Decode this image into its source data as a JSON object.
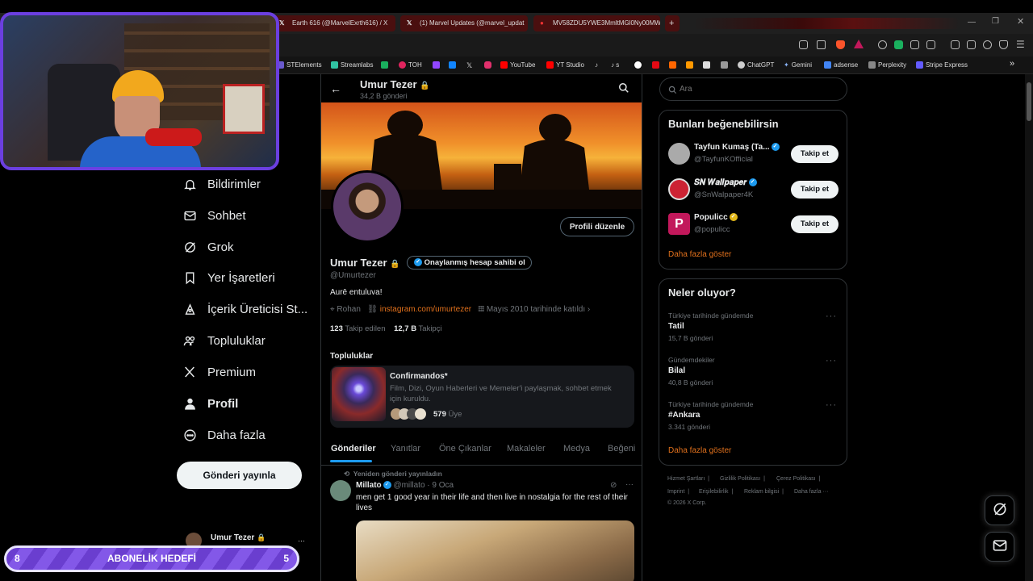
{
  "browser": {
    "tabs": [
      {
        "label": "Earth 616 (@MarvelExrth616) / X"
      },
      {
        "label": "(1) Marvel Updates (@marvel_updat"
      },
      {
        "label": "MV58ZDU5YWE3MmltMGl0Ny00MW"
      }
    ],
    "new_tab": "+",
    "bookmarks": [
      {
        "label": "STElements",
        "color": "#6a5acd"
      },
      {
        "label": "Streamlabs",
        "color": "#31c3a2"
      },
      {
        "label": "",
        "color": "#1ab05e"
      },
      {
        "label": "TOH",
        "color": "#e0245e"
      },
      {
        "label": "",
        "color": "#9146ff"
      },
      {
        "label": "",
        "color": "#1185fe"
      },
      {
        "label": "",
        "color": "#aaaaaa"
      },
      {
        "label": "",
        "color": "#e1306c"
      },
      {
        "label": "YouTube",
        "color": "#ff0000"
      },
      {
        "label": "YT Studio",
        "color": "#ff0000"
      },
      {
        "label": "",
        "color": "#cccccc"
      },
      {
        "label": "s",
        "color": "#cccccc"
      },
      {
        "label": "",
        "color": "#ffffff"
      },
      {
        "label": "",
        "color": "#e50914"
      },
      {
        "label": "",
        "color": "#ff6600"
      },
      {
        "label": "",
        "color": "#53fc18"
      },
      {
        "label": "",
        "color": "#ff9900"
      },
      {
        "label": "",
        "color": "#dddddd"
      },
      {
        "label": "ChatGPT",
        "color": "#cccccc"
      },
      {
        "label": "Gemini",
        "color": "#8ab4f8"
      },
      {
        "label": "adsense",
        "color": "#4285f4"
      },
      {
        "label": "Perplexity",
        "color": "#cccccc"
      },
      {
        "label": "Stripe Express",
        "color": "#635bff"
      }
    ],
    "more": "»"
  },
  "sidebar": {
    "items": [
      {
        "label": "Bildirimler",
        "icon": "bell-icon"
      },
      {
        "label": "Sohbet",
        "icon": "mail-icon"
      },
      {
        "label": "Grok",
        "icon": "grok-icon"
      },
      {
        "label": "Yer İşaretleri",
        "icon": "bookmark-icon"
      },
      {
        "label": "İçerik Üreticisi St...",
        "icon": "creator-icon"
      },
      {
        "label": "Topluluklar",
        "icon": "communities-icon"
      },
      {
        "label": "Premium",
        "icon": "x-logo-icon"
      },
      {
        "label": "Profil",
        "icon": "person-icon"
      },
      {
        "label": "Daha fazla",
        "icon": "more-circle-icon"
      }
    ],
    "post_button": "Gönderi yayınla",
    "account_name": "Umur Tezer",
    "account_more": "···"
  },
  "goal_overlay": {
    "left": "8",
    "title": "ABONELİK HEDEFİ",
    "right": "5"
  },
  "profile": {
    "header_name": "Umur Tezer",
    "header_posts": "34,2 B gönderi",
    "edit_button": "Profili düzenle",
    "name": "Umur Tezer",
    "verify_badge": "Onaylanmış hesap sahibi ol",
    "handle": "@Umurtezer",
    "bio": "Aurē entuluva!",
    "location": "Rohan",
    "link": "instagram.com/umurtezer",
    "joined": "Mayıs 2010 tarihinde katıldı",
    "following_count": "123",
    "following_label": "Takip edilen",
    "followers_count": "12,7 B",
    "followers_label": "Takipçi",
    "communities_heading": "Topluluklar",
    "community": {
      "name": "Confirmandos*",
      "desc": "Film, Dizi, Oyun Haberleri ve Memeler'i paylaşmak, sohbet etmek için kuruldu.",
      "members": "579",
      "members_label": "Üye"
    },
    "tabs": [
      "Gönderiler",
      "Yanıtlar",
      "Öne Çıkanlar",
      "Makaleler",
      "Medya",
      "Beğeni"
    ],
    "active_tab": "Gönderiler"
  },
  "post": {
    "repost_label": "Yeniden gönderi yayınladın",
    "author": "Millato",
    "handle": "@millato",
    "date": "· 9 Oca",
    "text": "men get 1 good year in their life and then live in nostalgia for the rest of their lives"
  },
  "right": {
    "search_placeholder": "Ara",
    "suggest_title": "Bunları beğenebilirsin",
    "suggestions": [
      {
        "name": "Tayfun Kumaş (Ta...",
        "handle": "@TayfunKOfficial",
        "button": "Takip et",
        "badge": "blue"
      },
      {
        "name": "𝑺𝑵 𝑾𝒂𝒍𝒍𝒑𝒂𝒑𝒆𝒓",
        "handle": "@SnWalpaper4K",
        "button": "Takip et",
        "badge": "blue"
      },
      {
        "name": "Populicc",
        "handle": "@populicc",
        "button": "Takip et",
        "badge": "gold"
      }
    ],
    "show_more": "Daha fazla göster",
    "trends_title": "Neler oluyor?",
    "trends": [
      {
        "context": "Türkiye tarihinde gündemde",
        "topic": "Tatil",
        "count": "15,7 B gönderi"
      },
      {
        "context": "Gündemdekiler",
        "topic": "Bilal",
        "count": "40,8 B gönderi"
      },
      {
        "context": "Türkiye tarihinde gündemde",
        "topic": "#Ankara",
        "count": "3.341 gönderi"
      }
    ],
    "trends_more": "Daha fazla göster",
    "footer": [
      "Hizmet Şartları",
      "Gizlilik Politikası",
      "Çerez Politikası",
      "Imprint",
      "Erişilebilirlik",
      "Reklam bilgisi",
      "Daha fazla ···",
      "© 2026 X Corp."
    ]
  },
  "colors": {
    "accent": "#1d9bf0",
    "link": "#e0701c",
    "brave": "#fb542b",
    "goal_purple": "#6a3ecf",
    "webcam_border": "#6b3fe0"
  }
}
